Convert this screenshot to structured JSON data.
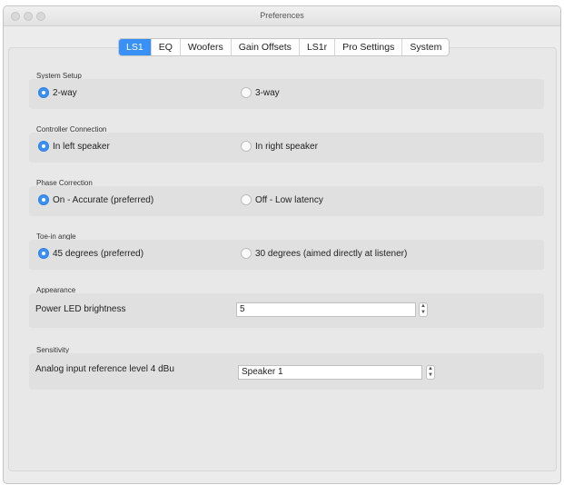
{
  "window": {
    "title": "Preferences"
  },
  "tabs": [
    "LS1",
    "EQ",
    "Woofers",
    "Gain Offsets",
    "LS1r",
    "Pro Settings",
    "System"
  ],
  "active_tab": "LS1",
  "sections": {
    "system_setup": {
      "label": "System Setup",
      "options": [
        "2-way",
        "3-way"
      ],
      "selected": "2-way"
    },
    "controller_connection": {
      "label": "Controller Connection",
      "options": [
        "In left speaker",
        "In right speaker"
      ],
      "selected": "In left speaker"
    },
    "phase_correction": {
      "label": "Phase Correction",
      "options": [
        "On - Accurate (preferred)",
        "Off - Low latency"
      ],
      "selected": "On - Accurate (preferred)"
    },
    "toe_in": {
      "label": "Toe-in angle",
      "options": [
        "45 degrees (preferred)",
        "30 degrees (aimed directly at listener)"
      ],
      "selected": "45 degrees (preferred)"
    },
    "appearance": {
      "label": "Appearance",
      "field_label": "Power LED brightness",
      "value": "5"
    },
    "sensitivity": {
      "label": "Sensitivity",
      "field_label": "Analog input reference level 4 dBu",
      "value": "Speaker 1"
    }
  },
  "colors": {
    "accent": "#3a91f5",
    "window_bg": "#ececec",
    "group_bg": "#e0e0e0"
  }
}
